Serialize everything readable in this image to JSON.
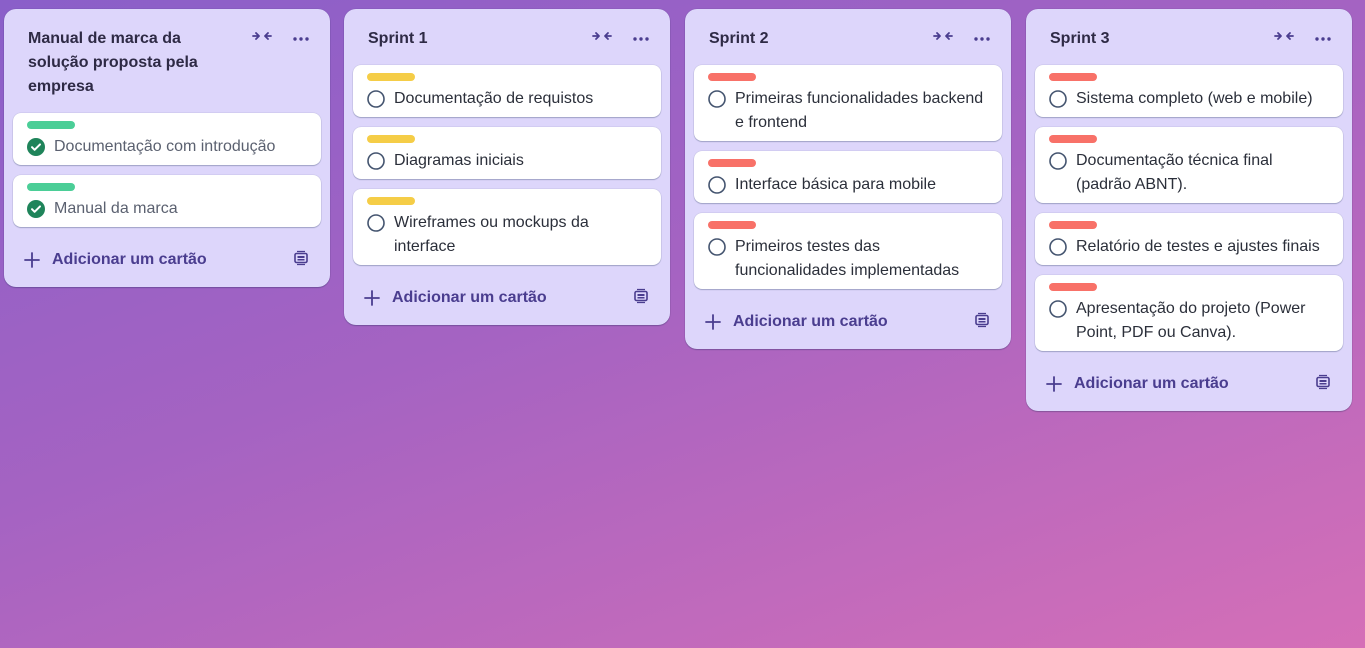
{
  "colors": {
    "green": "#4bce97",
    "yellow": "#f5cd47",
    "red": "#f87168",
    "list_bg": "#ddd6fb",
    "accent": "#4a3d8f",
    "check_done": "#1f845a"
  },
  "icons": {
    "collapse": "collapse-icon",
    "menu": "more-icon",
    "plus": "plus-icon",
    "template": "card-template-icon",
    "check_done": "check-circle-icon",
    "check_open": "circle-outline-icon"
  },
  "lists": [
    {
      "title": "Manual de marca da solução proposta pela empresa",
      "add_label": "Adicionar um cartão",
      "cards": [
        {
          "label": "green",
          "text": "Documentação com introdução",
          "done": true
        },
        {
          "label": "green",
          "text": "Manual da marca",
          "done": true
        }
      ]
    },
    {
      "title": "Sprint 1",
      "add_label": "Adicionar um cartão",
      "cards": [
        {
          "label": "yellow",
          "text": "Documentação de requistos",
          "done": false
        },
        {
          "label": "yellow",
          "text": "Diagramas iniciais",
          "done": false
        },
        {
          "label": "yellow",
          "text": "Wireframes ou mockups da interface",
          "done": false
        }
      ]
    },
    {
      "title": "Sprint 2",
      "add_label": "Adicionar um cartão",
      "cards": [
        {
          "label": "red",
          "text": "Primeiras funcionalidades backend e frontend",
          "done": false
        },
        {
          "label": "red",
          "text": "Interface básica para mobile",
          "done": false
        },
        {
          "label": "red",
          "text": "Primeiros testes das funcionalidades implementadas",
          "done": false
        }
      ]
    },
    {
      "title": "Sprint 3",
      "add_label": "Adicionar um cartão",
      "cards": [
        {
          "label": "red",
          "text": "Sistema completo (web e mobile)",
          "done": false
        },
        {
          "label": "red",
          "text": "Documentação técnica final (padrão ABNT).",
          "done": false
        },
        {
          "label": "red",
          "text": "Relatório de testes e ajustes finais",
          "done": false
        },
        {
          "label": "red",
          "text": "Apresentação do projeto (Power Point, PDF ou Canva).",
          "done": false
        }
      ]
    }
  ]
}
